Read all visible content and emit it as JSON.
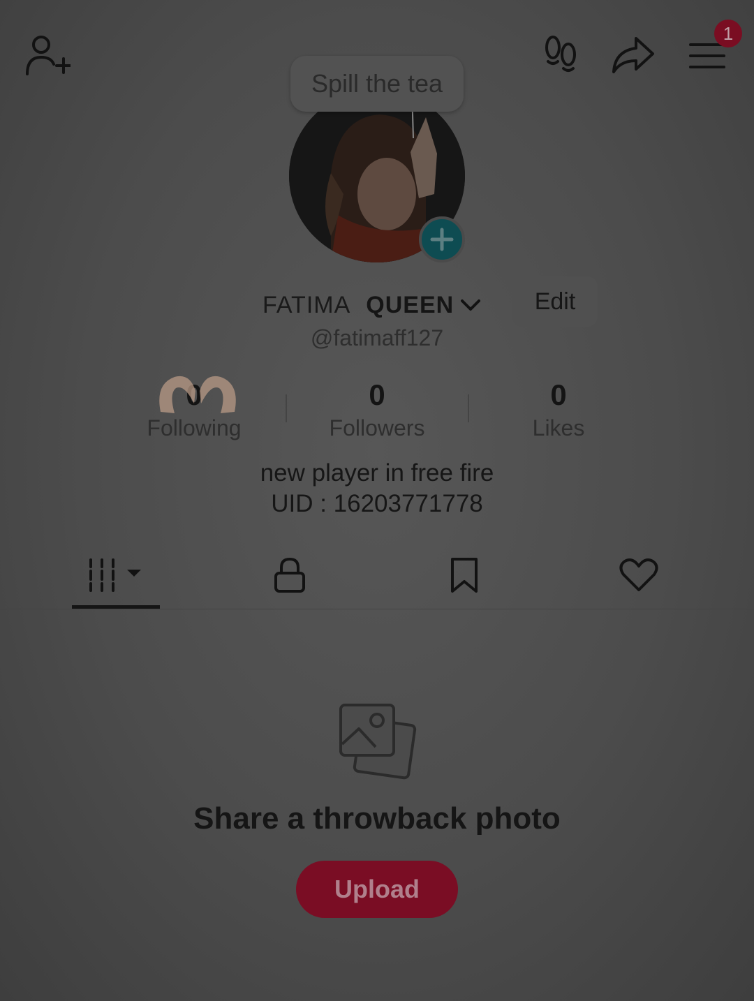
{
  "header": {
    "notification_count": "1",
    "icons": [
      "add-friend-icon",
      "footprints-icon",
      "share-icon",
      "menu-icon"
    ]
  },
  "tooltip": {
    "text": "Spill the tea"
  },
  "profile": {
    "name_first": "FATIMA",
    "name_second": "QUEEN",
    "edit_label": "Edit",
    "username": "@fatimaff127",
    "bio_line1": "new player in free fire",
    "bio_line2": "UID : 16203771778"
  },
  "stats": [
    {
      "value": "0",
      "label": "Following"
    },
    {
      "value": "0",
      "label": "Followers"
    },
    {
      "value": "0",
      "label": "Likes"
    }
  ],
  "tabs": [
    "videos-grid-icon",
    "lock-icon",
    "bookmark-icon",
    "heart-icon"
  ],
  "empty_state": {
    "title": "Share a throwback photo",
    "button_label": "Upload"
  },
  "colors": {
    "accent": "#7a0d24",
    "avatar_add": "#0e4c52",
    "overlay_bg": "#4a4a4a"
  }
}
